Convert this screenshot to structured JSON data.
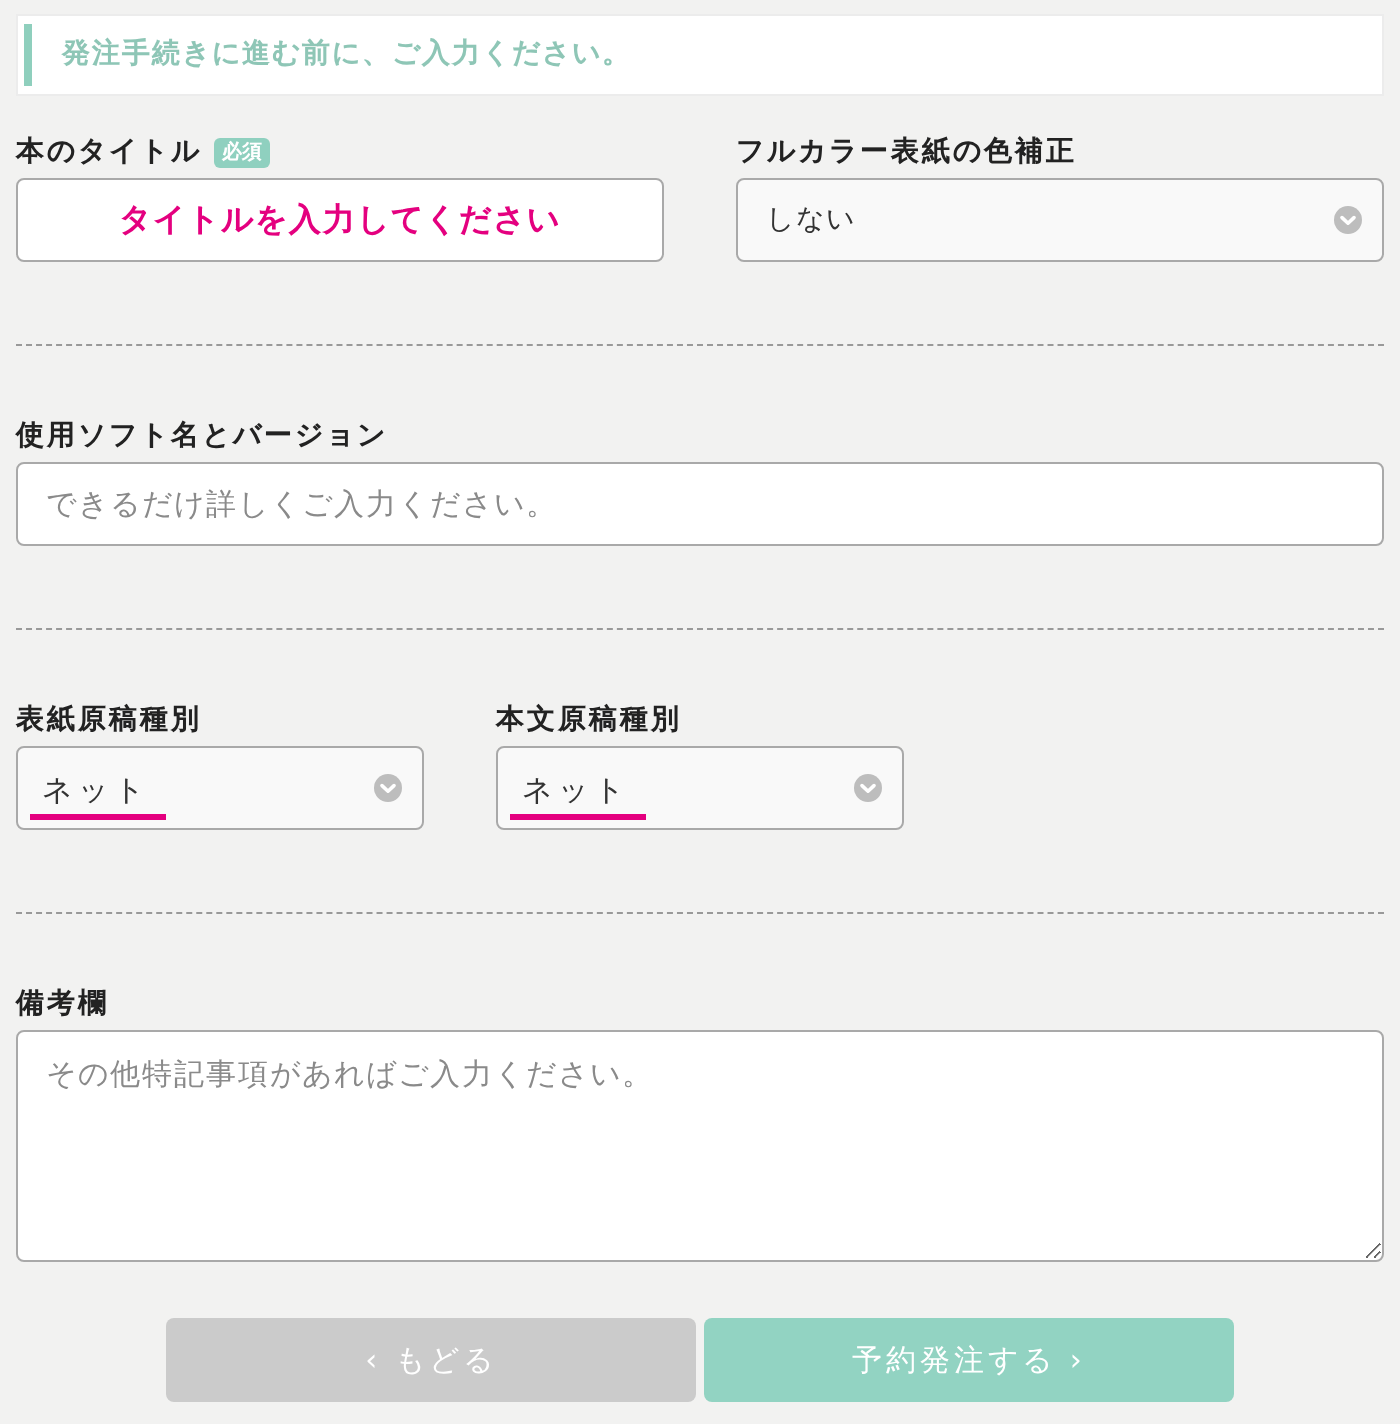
{
  "notice": {
    "text": "発注手続きに進む前に、ご入力ください。"
  },
  "sections": [
    {
      "kind": "pair",
      "fields": [
        {
          "kind": "text",
          "label": "本のタイトル",
          "badge": "必須",
          "placeholder": "タイトルを入力してください",
          "highlighted": true
        },
        {
          "kind": "select",
          "label": "フルカラー表紙の色補正",
          "value": "しない",
          "highlighted": false
        }
      ]
    },
    {
      "kind": "single",
      "fields": [
        {
          "kind": "text",
          "label": "使用ソフト名とバージョン",
          "placeholder": "できるだけ詳しくご入力ください。",
          "highlighted": false
        }
      ]
    },
    {
      "kind": "narrow-pair",
      "fields": [
        {
          "kind": "select",
          "label": "表紙原稿種別",
          "value": "ネット",
          "highlighted": true
        },
        {
          "kind": "select",
          "label": "本文原稿種別",
          "value": "ネット",
          "highlighted": true
        }
      ]
    },
    {
      "kind": "single",
      "fields": [
        {
          "kind": "textarea",
          "label": "備考欄",
          "placeholder": "その他特記事項があればご入力ください。"
        }
      ]
    }
  ],
  "buttons": [
    {
      "kind": "back",
      "label": "‹ もどる"
    },
    {
      "kind": "submit",
      "label": "予約発注する ›"
    }
  ]
}
